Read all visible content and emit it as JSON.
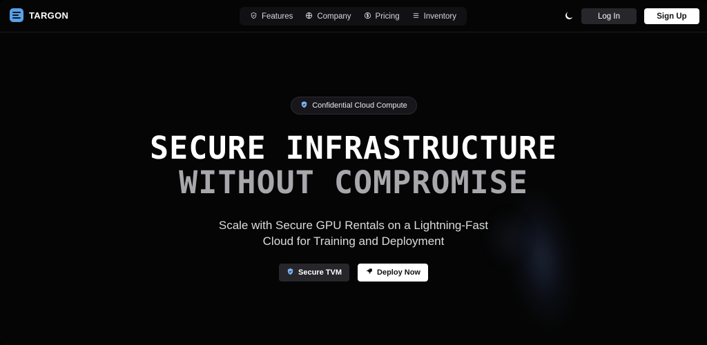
{
  "brand": {
    "name": "TARGON",
    "color": "#5aa0e6"
  },
  "nav": {
    "items": [
      {
        "label": "Features",
        "icon": "shield-check-icon"
      },
      {
        "label": "Company",
        "icon": "globe-icon"
      },
      {
        "label": "Pricing",
        "icon": "dollar-circle-icon"
      },
      {
        "label": "Inventory",
        "icon": "list-icon"
      }
    ],
    "theme_icon": "moon-icon",
    "login_label": "Log In",
    "signup_label": "Sign Up"
  },
  "hero": {
    "badge": {
      "label": "Confidential Cloud Compute",
      "icon": "shield-check-icon",
      "icon_color": "#7db3f0"
    },
    "headline_line1": "SECURE INFRASTRUCTURE",
    "headline_line2": "WITHOUT COMPROMISE",
    "subtitle_line1": "Scale with Secure GPU Rentals on a Lightning-Fast",
    "subtitle_line2": "Cloud for Training and Deployment",
    "cta_secondary": {
      "label": "Secure TVM",
      "icon": "shield-check-icon"
    },
    "cta_primary": {
      "label": "Deploy Now",
      "icon": "rocket-icon"
    }
  }
}
